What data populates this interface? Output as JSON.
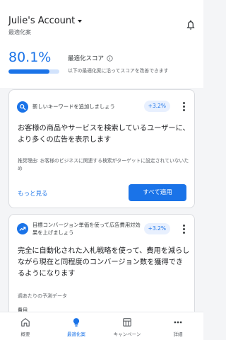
{
  "account": {
    "name": "Julie's Account",
    "subtitle": "最適化案"
  },
  "score": {
    "value": "80.1%",
    "progress_fraction": 0.801,
    "title": "最適化スコア",
    "description": "以下の最適化案に沿ってスコアを改善できます"
  },
  "cards": [
    {
      "icon": "search-icon",
      "title": "新しいキーワードを追加しましょう",
      "impact": "+3.2%",
      "body": "お客様の商品やサービスを検索しているユーザーに、より多くの広告を表示します",
      "reason": "推奨理由: お客様のビジネスに関連する検索がターゲットに設定されていないため",
      "link_label": "もっと見る",
      "button_label": "すべて適用"
    },
    {
      "icon": "trending-up-icon",
      "title": "目標コンバージョン単価を使って広告費用対効果を上げましょう",
      "impact": "+3.2%",
      "body": "完全に自動化された入札戦略を使って、費用を減らしながら現在と同程度のコンバージョン数を獲得できるようになります",
      "forecast_label": "週あたりの予測データ",
      "cost_label": "費用"
    }
  ],
  "nav": [
    {
      "label": "概要",
      "icon": "home-icon",
      "active": false
    },
    {
      "label": "最適化案",
      "icon": "lightbulb-icon",
      "active": true
    },
    {
      "label": "キャンペーン",
      "icon": "campaign-icon",
      "active": false
    },
    {
      "label": "詳細",
      "icon": "more-horizontal-icon",
      "active": false
    }
  ],
  "colors": {
    "accent": "#1a73e8",
    "chip_bg": "#e8f0fe",
    "bar_track": "#d2e3fc"
  }
}
